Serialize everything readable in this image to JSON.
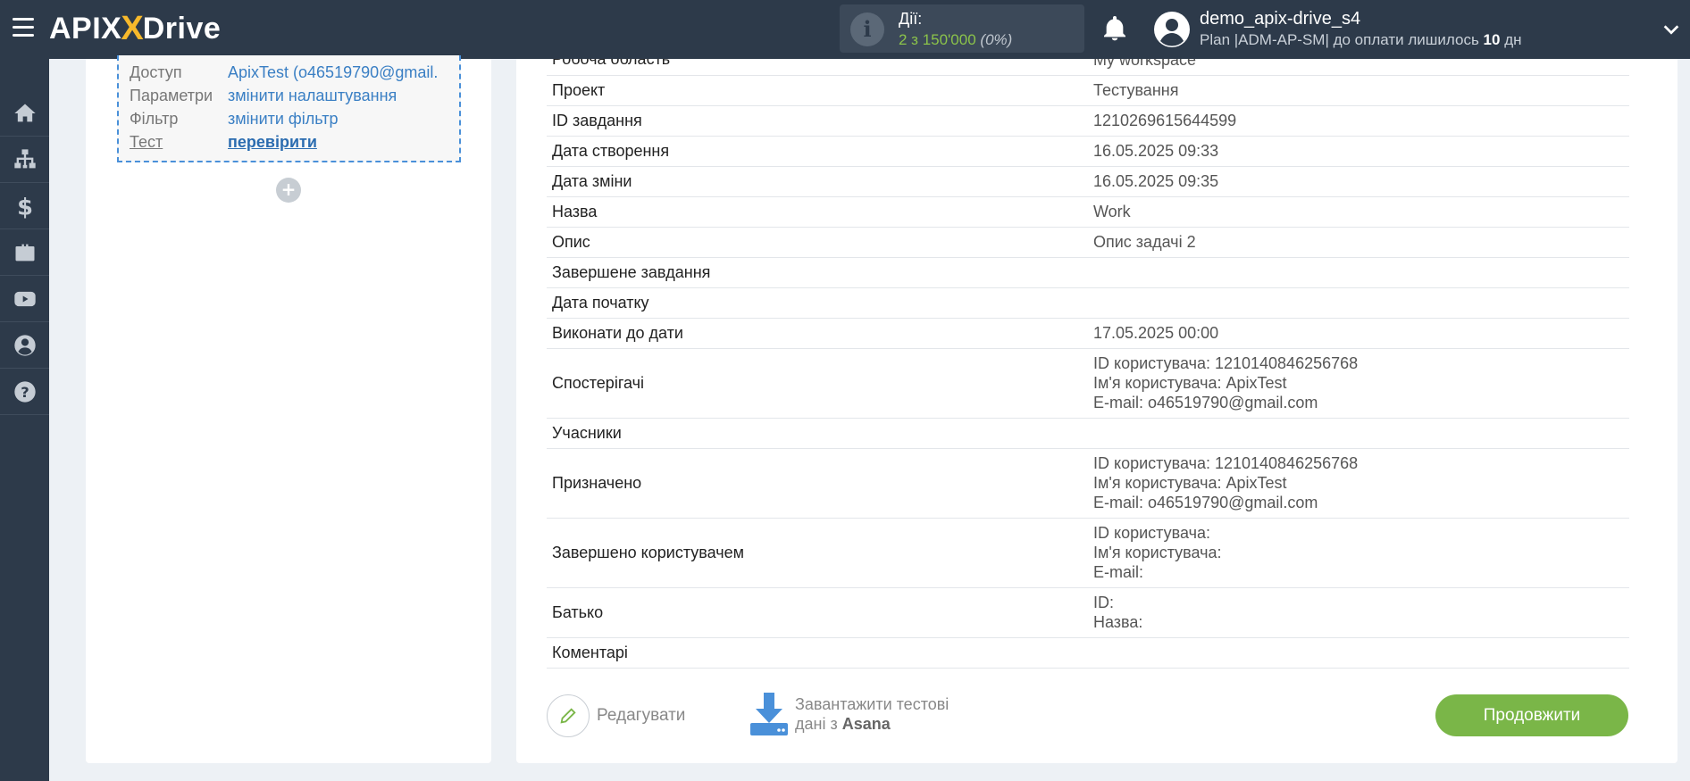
{
  "header": {
    "logo_left": "APIX",
    "logo_x": "X",
    "logo_right": "Drive",
    "actions_label": "Дії:",
    "actions_value": "2 з 150'000",
    "actions_pct": "(0%)",
    "username": "demo_apix-drive_s4",
    "plan_prefix": "Plan |ADM-AP-SM| до оплати лишилось ",
    "plan_days": "10",
    "plan_suffix": " дн"
  },
  "sidebar": {
    "items": [
      "home-icon",
      "sitemap-icon",
      "dollar-icon",
      "briefcase-icon",
      "youtube-icon",
      "user-icon",
      "help-icon"
    ]
  },
  "connection": {
    "rows": [
      {
        "key": "Доступ",
        "value": "ApixTest (o46519790@gmail."
      },
      {
        "key": "Параметри",
        "value": "змінити налаштування"
      },
      {
        "key": "Фільтр",
        "value": "змінити фільтр"
      },
      {
        "key": "Тест",
        "value": "перевірити"
      }
    ],
    "add_label": "+"
  },
  "data_table": {
    "rows": [
      {
        "key": "Робоча область",
        "lines": [
          "My workspace"
        ]
      },
      {
        "key": "Проект",
        "lines": [
          "Тестування"
        ]
      },
      {
        "key": "ID завдання",
        "lines": [
          "1210269615644599"
        ]
      },
      {
        "key": "Дата створення",
        "lines": [
          "16.05.2025 09:33"
        ]
      },
      {
        "key": "Дата зміни",
        "lines": [
          "16.05.2025 09:35"
        ]
      },
      {
        "key": "Назва",
        "lines": [
          "Work"
        ]
      },
      {
        "key": "Опис",
        "lines": [
          "Опис задачі 2"
        ]
      },
      {
        "key": "Завершене завдання",
        "lines": [
          ""
        ]
      },
      {
        "key": "Дата початку",
        "lines": [
          ""
        ]
      },
      {
        "key": "Виконати до дати",
        "lines": [
          "17.05.2025 00:00"
        ]
      },
      {
        "key": "Спостерігачі",
        "lines": [
          "ID користувача: 1210140846256768",
          "Ім'я користувача: ApixTest",
          "E-mail: o46519790@gmail.com"
        ]
      },
      {
        "key": "Учасники",
        "lines": [
          ""
        ]
      },
      {
        "key": "Призначено",
        "lines": [
          "ID користувача: 1210140846256768",
          "Ім'я користувача: ApixTest",
          "E-mail: o46519790@gmail.com"
        ]
      },
      {
        "key": "Завершено користувачем",
        "lines": [
          "ID користувача:",
          "Ім'я користувача:",
          "E-mail:"
        ]
      },
      {
        "key": "Батько",
        "lines": [
          "ID:",
          "Назва:"
        ]
      },
      {
        "key": "Коментарі",
        "lines": [
          ""
        ]
      }
    ]
  },
  "footer": {
    "edit_label": "Редагувати",
    "download_line1": "Завантажити тестові",
    "download_line2_prefix": "дані з ",
    "download_source": "Asana",
    "continue_label": "Продовжити"
  },
  "colors": {
    "topbar": "#2d3a4a",
    "accent_green": "#7ab648",
    "link_blue": "#3a7fc4",
    "logo_x": "#f7b92b"
  }
}
